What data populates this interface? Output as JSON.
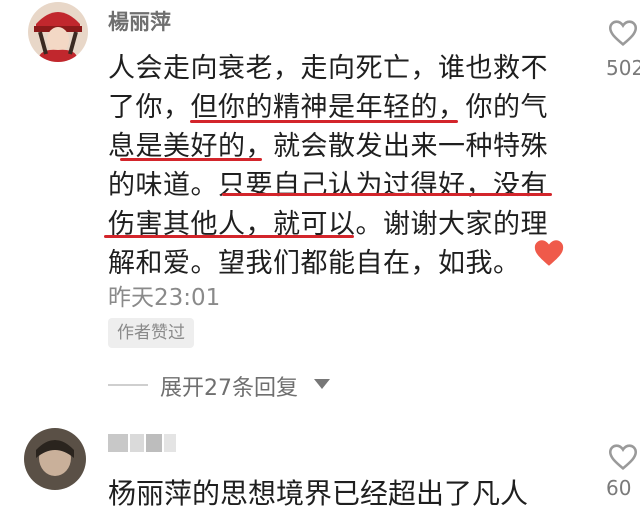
{
  "comment1": {
    "username": "楊丽萍",
    "lines": [
      "人会走向衰老，走向死亡，谁也救不",
      "了你，但你的精神是年轻的，你的气",
      "息是美好的，就会散发出来一种特殊",
      "的味道。只要自己认为过得好，没有",
      "伤害其他人，就可以。谢谢大家的理",
      "解和爱。望我们都能自在，如我。"
    ],
    "emoji": "red-heart",
    "time": "昨天23:01",
    "badge": "作者赞过",
    "likes": "502",
    "expand": "展开27条回复"
  },
  "comment2": {
    "text": "杨丽萍的思想境界已经超出了凡人",
    "likes": "60"
  },
  "colors": {
    "underline": "#d3252b",
    "heart": "#ef5a4a"
  }
}
